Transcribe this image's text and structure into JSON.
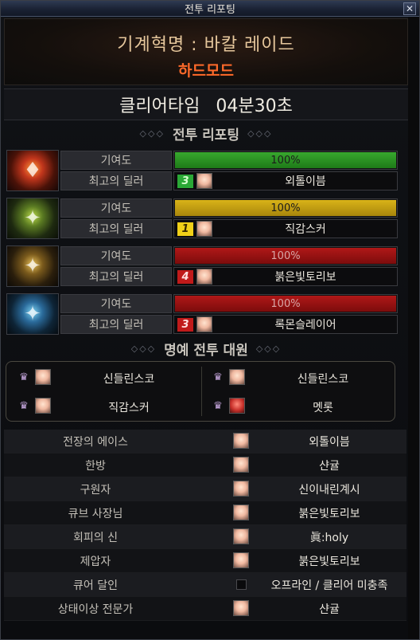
{
  "window": {
    "title": "전투 리포팅",
    "close_glyph": "✕"
  },
  "dungeon": {
    "name": "기계혁명 : 바칼 레이드",
    "difficulty": "하드모드"
  },
  "clear_time": {
    "label": "클리어타임",
    "value": "04분30초"
  },
  "battle_report": {
    "header": "전투 리포팅",
    "deco_left": "◇◇◇",
    "deco_right": "◇◇◇",
    "contribution_label": "기여도",
    "top_dealer_label": "최고의 딜러",
    "bosses": [
      {
        "portrait_icon": "red-boss-icon",
        "contribution_text": "100%",
        "contribution_value": 100,
        "bar_color": "#2aa836",
        "rank": "3",
        "rank_color": "#2aa836",
        "dealer": "외톨이븜"
      },
      {
        "portrait_icon": "green-boss-icon",
        "contribution_text": "100%",
        "contribution_value": 100,
        "bar_color": "#d9b318",
        "rank": "1",
        "rank_color": "#f0d018",
        "dealer": "직감스커"
      },
      {
        "portrait_icon": "gold-boss-icon",
        "contribution_text": "100%",
        "contribution_value": 100,
        "bar_color": "#b01818",
        "rank": "4",
        "rank_color": "#c01a1a",
        "dealer": "붉은빛토리보"
      },
      {
        "portrait_icon": "blue-boss-icon",
        "contribution_text": "100%",
        "contribution_value": 100,
        "bar_color": "#b01818",
        "rank": "3",
        "rank_color": "#c01a1a",
        "dealer": "록몬슬레이어"
      }
    ]
  },
  "honor_battle": {
    "header": "명예 전투 대원",
    "deco_left": "◇◇◇",
    "deco_right": "◇◇◇",
    "members": [
      "신들린스코",
      "신들린스코",
      "직감스커",
      "멧롯"
    ]
  },
  "awards": [
    {
      "title": "전장의 에이스",
      "player": "외톨이븜"
    },
    {
      "title": "한방",
      "player": "샨귤"
    },
    {
      "title": "구원자",
      "player": "신이내린계시"
    },
    {
      "title": "큐브 사장님",
      "player": "붉은빛토리보"
    },
    {
      "title": "회피의 신",
      "player": "眞:holy"
    },
    {
      "title": "제압자",
      "player": "붉은빛토리보"
    },
    {
      "title": "큐어 달인",
      "player": "오프라인 / 클리어 미충족"
    },
    {
      "title": "상태이상 전문가",
      "player": "샨귤"
    }
  ]
}
